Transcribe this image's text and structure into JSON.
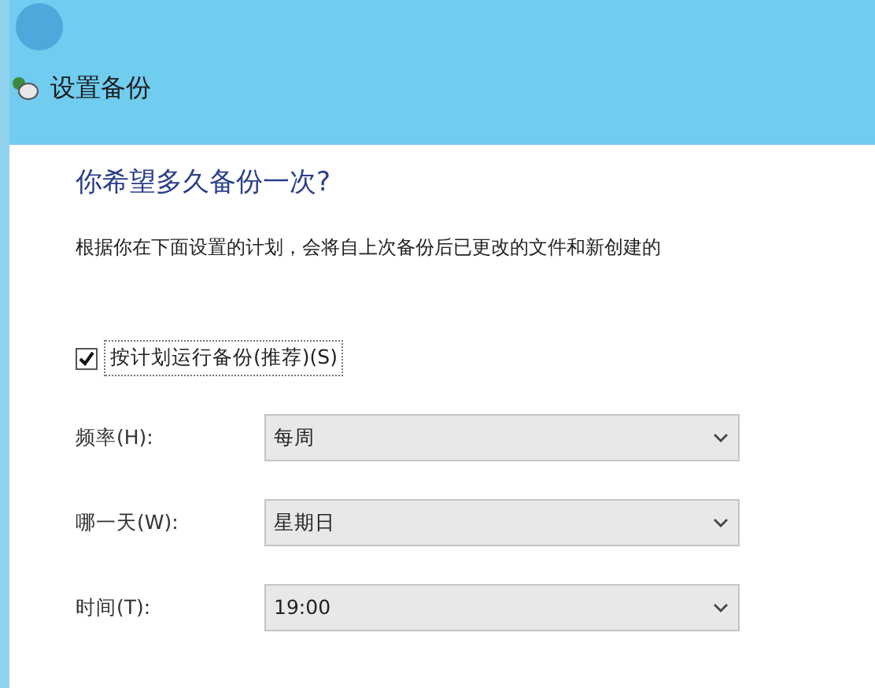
{
  "window": {
    "title": "设置备份"
  },
  "heading": "你希望多久备份一次?",
  "description": "根据你在下面设置的计划，会将自上次备份后已更改的文件和新创建的",
  "schedule_checkbox": {
    "label": "按计划运行备份(推荐)(S)",
    "checked": true
  },
  "fields": [
    {
      "label": "频率(H):",
      "value": "每周",
      "kind": "dropdown"
    },
    {
      "label": "哪一天(W):",
      "value": "星期日",
      "kind": "dropdown"
    },
    {
      "label": "时间(T):",
      "value": "19:00",
      "kind": "dropdown"
    }
  ]
}
